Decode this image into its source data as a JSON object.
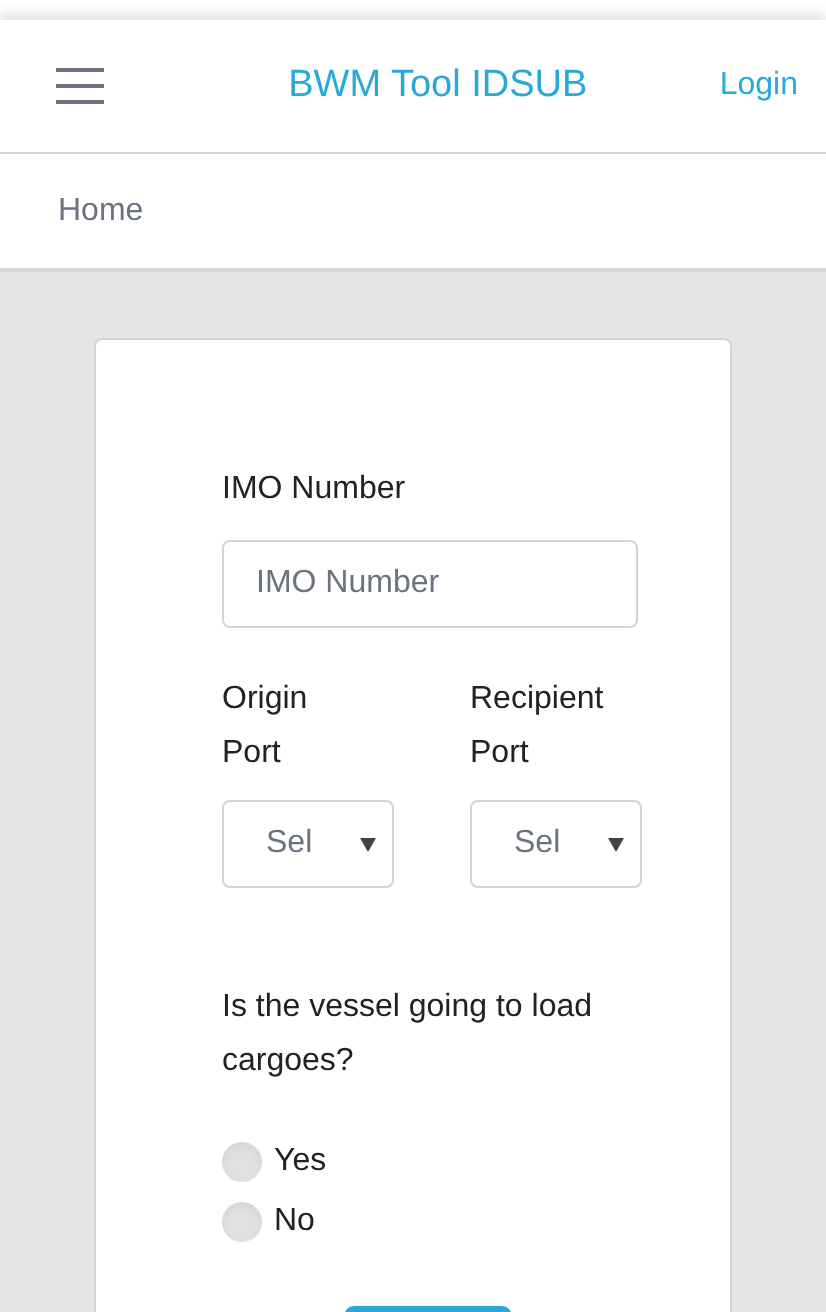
{
  "header": {
    "title": "BWM Tool IDSUB",
    "login": "Login"
  },
  "breadcrumb": "Home",
  "form": {
    "imo_label": "IMO Number",
    "imo_placeholder": "IMO Number",
    "ports": [
      {
        "label": "Origin Port",
        "value": "Sel"
      },
      {
        "label": "Recipient Port",
        "value": "Sel"
      }
    ],
    "question": "Is the vessel going to load cargoes?",
    "options": [
      {
        "label": "Yes",
        "selected": false
      },
      {
        "label": "No",
        "selected": false
      }
    ]
  }
}
